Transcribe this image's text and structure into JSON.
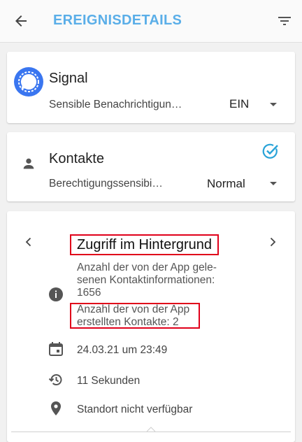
{
  "header": {
    "title": "EREIGNISDETAILS",
    "back_icon": "arrow-left-icon",
    "filter_icon": "filter-icon"
  },
  "app_card": {
    "name": "Signal",
    "setting_label": "Sensible Benachrichtigun…",
    "setting_value": "EIN",
    "logo_color": "#3a76f0"
  },
  "permission_card": {
    "name": "Kontakte",
    "setting_label": "Berechtigungssensibi…",
    "setting_value": "Normal",
    "check_color": "#29a3d8"
  },
  "event_card": {
    "title": "Zugriff im Hintergrund",
    "info_lines": [
      "Anzahl der von der App gele-",
      "senen Kontaktinformationen:",
      "1656",
      "Anzahl der von der App",
      "erstellten Kontakte: 2"
    ],
    "date": "24.03.21 um 23:49",
    "duration": "11 Sekunden",
    "location": "Standort nicht verfügbar"
  },
  "colors": {
    "accent": "#5aaee8",
    "highlight": "#e0001a"
  }
}
